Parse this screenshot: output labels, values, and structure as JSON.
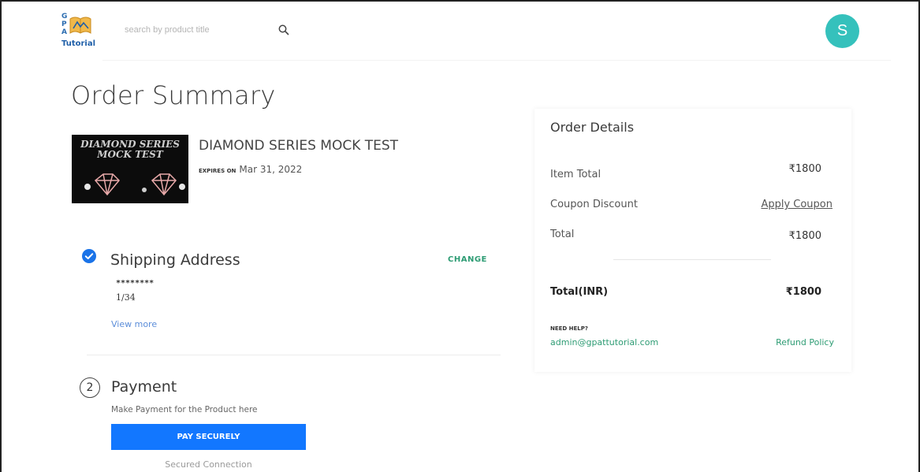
{
  "header": {
    "logo_letters": "G\nP\nA",
    "logo_text": "Tutorial",
    "search_placeholder": "search by product title",
    "avatar_initial": "S"
  },
  "order": {
    "title": "Order Summary",
    "product": {
      "image_text": "DIAMOND SERIES\nMOCK TEST",
      "name": "DIAMOND SERIES MOCK TEST",
      "expires_label": "EXPIRES ON",
      "expires_date": "Mar 31, 2022"
    },
    "shipping": {
      "title": "Shipping Address",
      "change_label": "CHANGE",
      "name": "********",
      "address": "1/34",
      "view_more": "View more"
    },
    "payment": {
      "step": "2",
      "title": "Payment",
      "description": "Make Payment for the Product here",
      "button_label": "PAY SECURELY",
      "secured_text": "Secured Connection"
    }
  },
  "details": {
    "title": "Order Details",
    "item_total_label": "Item Total",
    "item_total_value": "₹1800",
    "coupon_label": "Coupon Discount",
    "coupon_action": "Apply Coupon",
    "total_label": "Total",
    "total_value": "₹1800",
    "total_inr_label": "Total(INR)",
    "total_inr_value": "₹1800",
    "need_help": "NEED HELP?",
    "email": "admin@gpattutorial.com",
    "refund": "Refund Policy"
  },
  "colors": {
    "accent_green": "#2e9c74",
    "button_blue": "#1277ff",
    "avatar_teal": "#35c1bc",
    "check_blue": "#1a73e8"
  }
}
